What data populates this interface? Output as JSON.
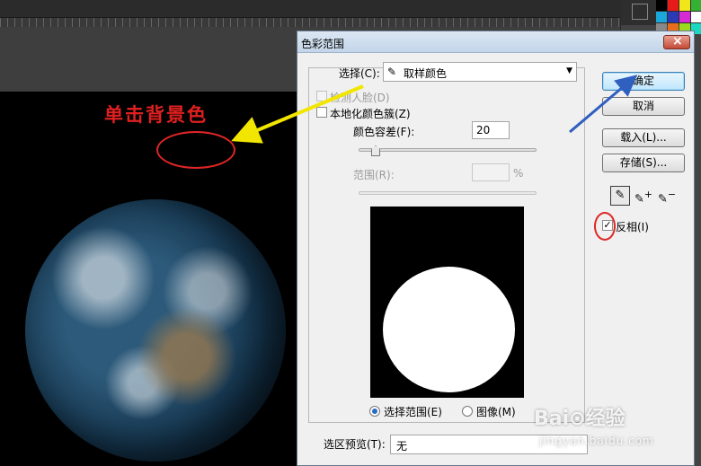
{
  "annotation": {
    "text": "单击背景色"
  },
  "dialog": {
    "title": "色彩范围",
    "close_icon": "close-icon",
    "select_label": "选择(C):",
    "select_value": "取样颜色",
    "detect_faces_label": "检测人脸(D)",
    "localized_clusters_label": "本地化颜色簇(Z)",
    "fuzziness_label": "颜色容差(F):",
    "fuzziness_value": "20",
    "range_label": "范围(R):",
    "range_unit": "%",
    "radio_selection_label": "选择范围(E)",
    "radio_image_label": "图像(M)",
    "selection_preview_label": "选区预览(T):",
    "selection_preview_value": "无",
    "invert_label": "反相(I)",
    "invert_checked": true,
    "buttons": {
      "ok": "确定",
      "cancel": "取消",
      "load": "载入(L)...",
      "save": "存储(S)..."
    },
    "tools": [
      "eyedropper-icon",
      "eyedropper-plus-icon",
      "eyedropper-minus-icon"
    ]
  },
  "watermark": {
    "brand": "Bai⊙经验",
    "sub": "jingyan.baidu.com"
  },
  "colors": {
    "annotation_red": "#e02626",
    "arrow_yellow": "#f2e600",
    "arrow_blue": "#2f5fbf"
  }
}
